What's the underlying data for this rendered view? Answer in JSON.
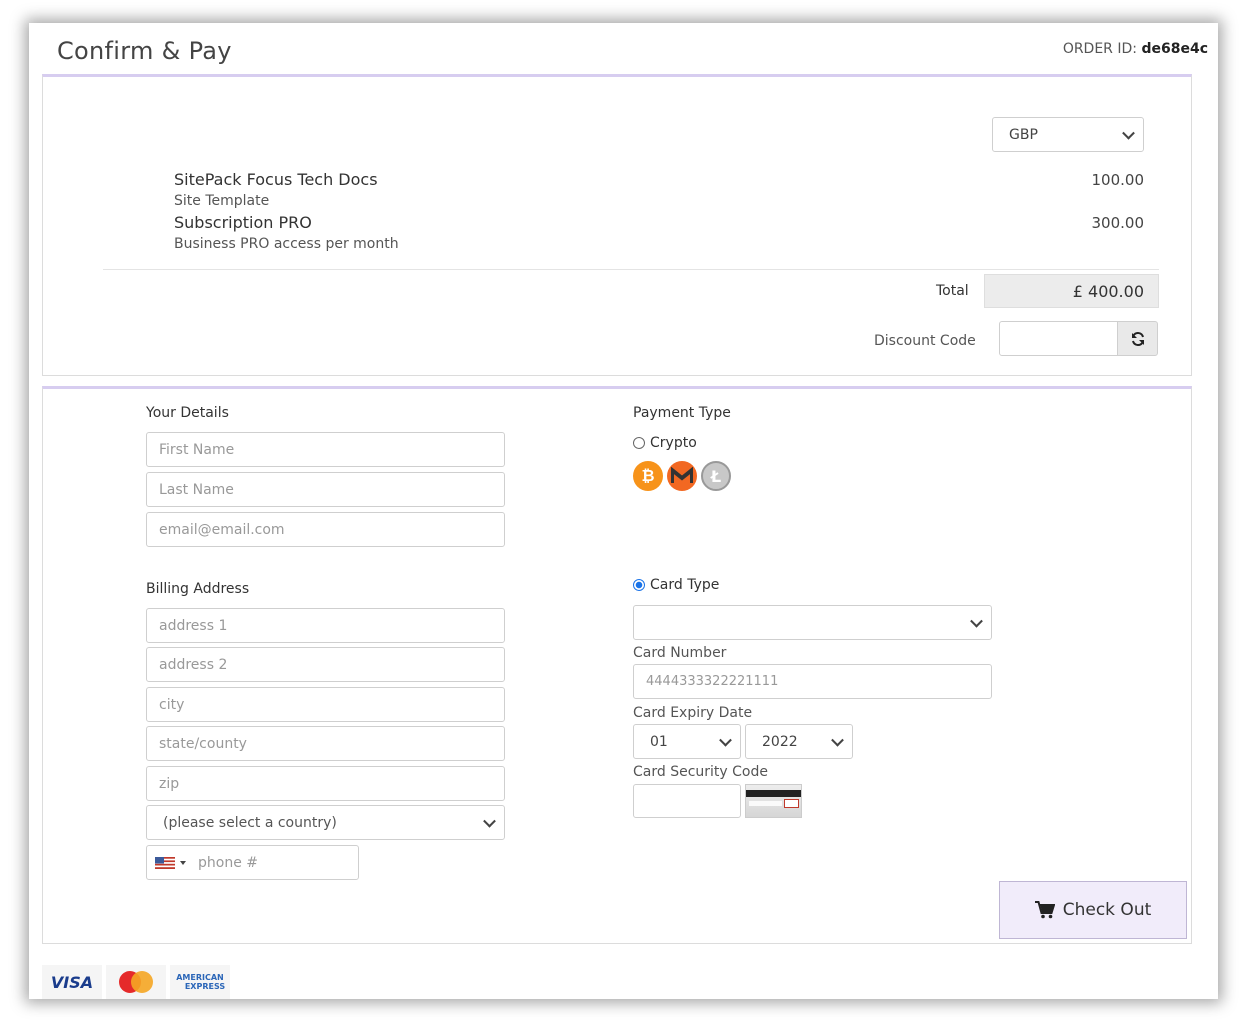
{
  "header": {
    "title": "Confirm & Pay",
    "order_label": "ORDER ID:",
    "order_id": "de68e4c"
  },
  "currency": {
    "selected": "GBP"
  },
  "items": [
    {
      "name": "SitePack Focus Tech Docs",
      "description": "Site Template",
      "price": "100.00"
    },
    {
      "name": "Subscription PRO",
      "description": "Business PRO access per month",
      "price": "300.00"
    }
  ],
  "total": {
    "label": "Total",
    "value": "£ 400.00"
  },
  "discount": {
    "label": "Discount Code",
    "value": ""
  },
  "details": {
    "heading": "Your Details",
    "first_name_placeholder": "First Name",
    "last_name_placeholder": "Last Name",
    "email_placeholder": "email@email.com"
  },
  "billing": {
    "heading": "Billing Address",
    "address1_placeholder": "address 1",
    "address2_placeholder": "address 2",
    "city_placeholder": "city",
    "state_placeholder": "state/county",
    "zip_placeholder": "zip",
    "country_selected": "(please select a country)",
    "phone_placeholder": "phone #",
    "phone_flag": "us-flag-icon"
  },
  "payment": {
    "heading": "Payment Type",
    "crypto_label": "Crypto",
    "crypto_selected": false,
    "coins": [
      "bitcoin-icon",
      "monero-icon",
      "litecoin-icon"
    ],
    "card_type_label": "Card Type",
    "card_type_selected": true,
    "card_type_value": "",
    "card_number_label": "Card Number",
    "card_number_value": "4444333322221111",
    "expiry_label": "Card Expiry Date",
    "expiry_month": "01",
    "expiry_year": "2022",
    "security_label": "Card Security Code",
    "security_value": ""
  },
  "checkout": {
    "label": "Check Out",
    "icon": "cart-icon"
  },
  "card_logos": [
    "VISA",
    "AMERICAN",
    "EXPRESS"
  ],
  "colors": {
    "accent": "#d7cdf0",
    "checkout_bg": "#f1ecfa",
    "bitcoin": "#f7931a",
    "monero": "#f26822",
    "litecoin": "#bebebe"
  }
}
